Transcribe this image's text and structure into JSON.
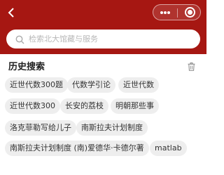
{
  "search": {
    "placeholder": "检索北大馆藏与服务"
  },
  "history": {
    "title": "历史搜索",
    "tags": [
      "近世代数300题",
      "代数学引论",
      "近世代数",
      "近世代数300",
      "长安的荔枝",
      "明朝那些事",
      "洛克菲勒写给儿子",
      "南斯拉夫计划制度",
      "南斯拉夫计划制度 (南)爱德华·卡德尔著",
      "matlab"
    ]
  },
  "colors": {
    "topbar": "#a61712",
    "tag_background": "#eeeeee",
    "placeholder": "#b8b8b8"
  },
  "icons": {
    "back": "chevron-left-icon",
    "more": "more-dots-icon",
    "close": "target-icon",
    "search": "search-icon",
    "trash": "trash-icon"
  }
}
